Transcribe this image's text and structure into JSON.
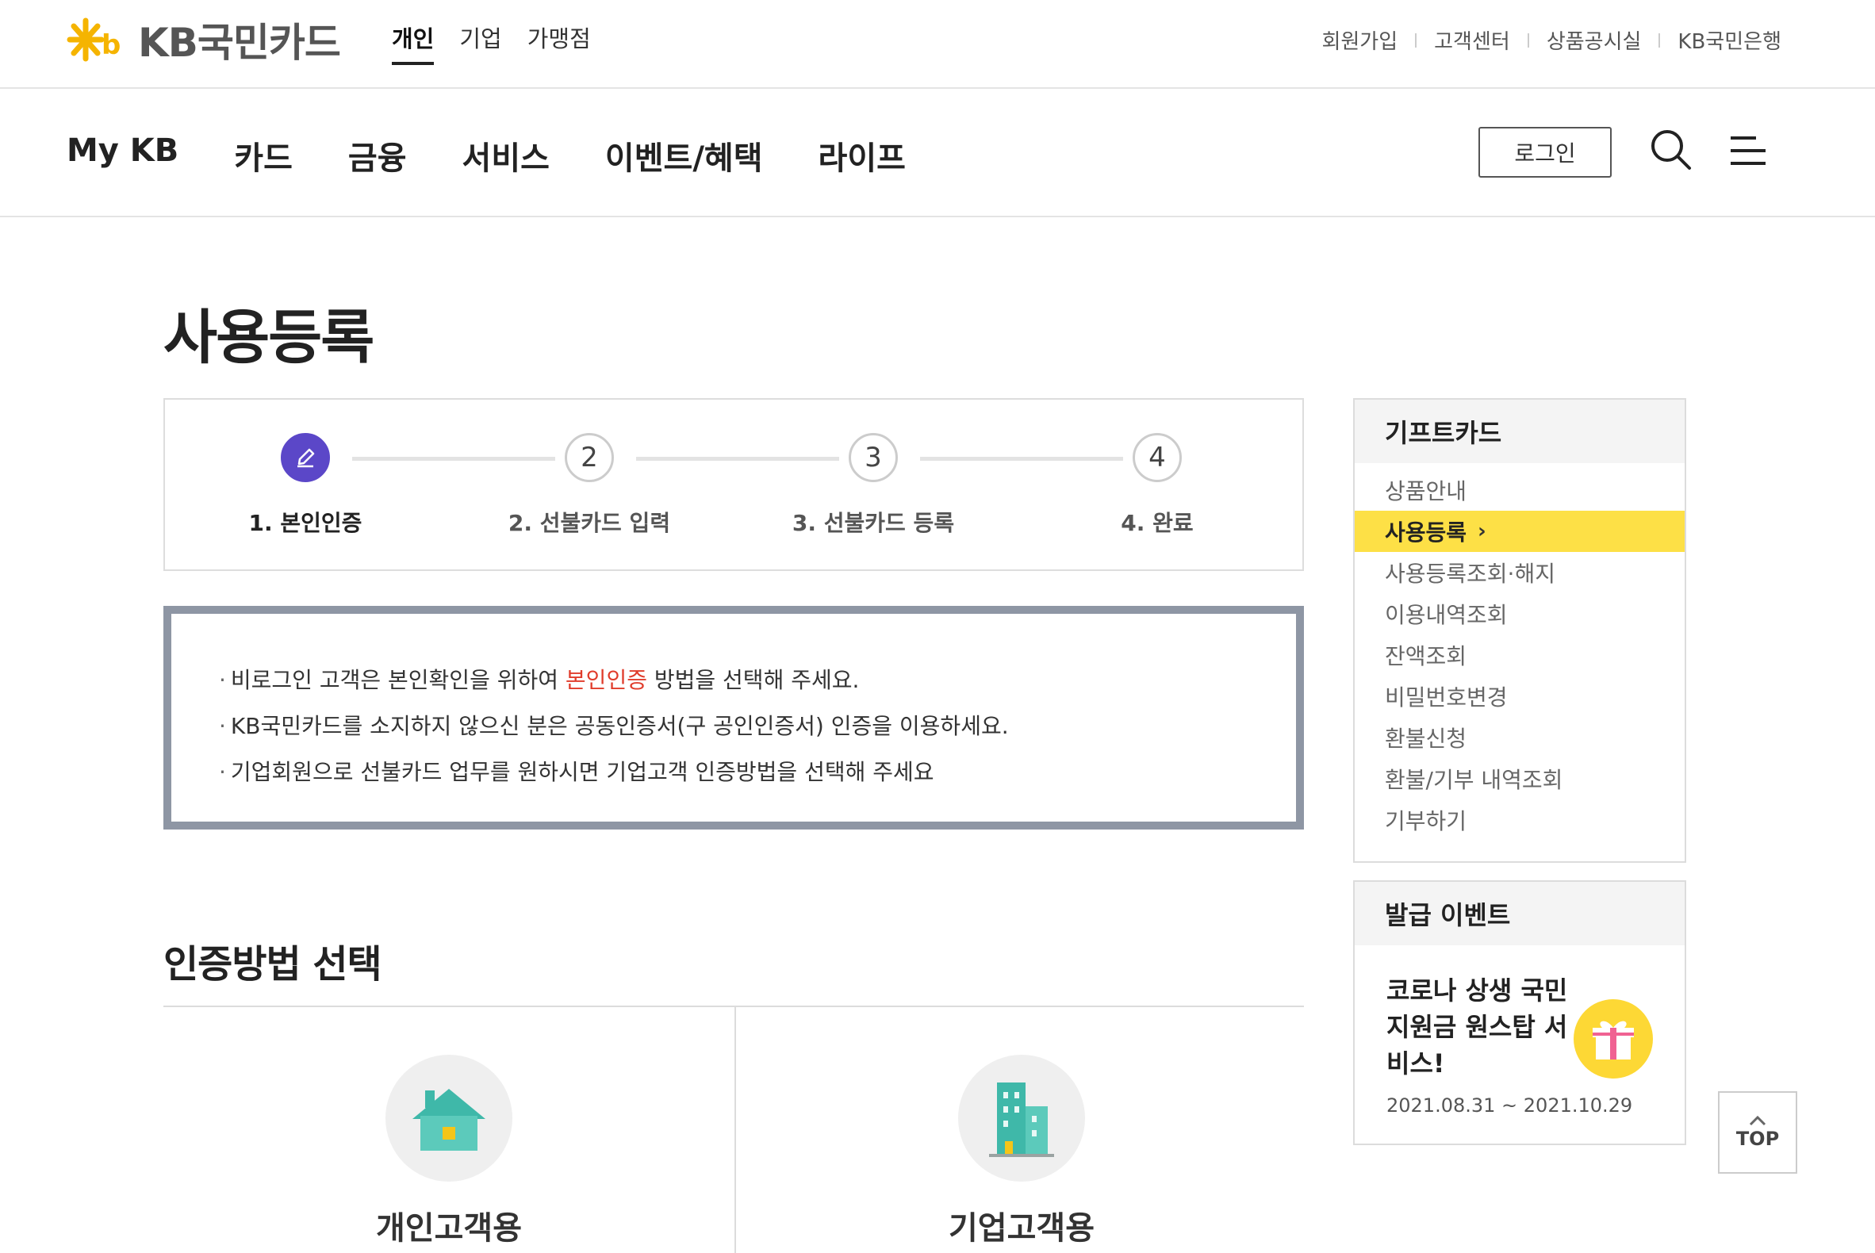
{
  "header": {
    "logo_text": "KB국민카드",
    "segments": [
      "개인",
      "기업",
      "가맹점"
    ],
    "utility_links": [
      "회원가입",
      "고객센터",
      "상품공시실",
      "KB국민은행"
    ]
  },
  "nav": {
    "items": [
      "My KB",
      "카드",
      "금융",
      "서비스",
      "이벤트/혜택",
      "라이프"
    ],
    "login_label": "로그인",
    "search_icon": "search-icon",
    "menu_icon": "hamburger-menu-icon"
  },
  "page": {
    "title": "사용등록"
  },
  "steps": [
    {
      "number": "1",
      "label": "1. 본인인증",
      "active": true,
      "icon": "pencil-icon"
    },
    {
      "number": "2",
      "label": "2. 선불카드 입력",
      "active": false
    },
    {
      "number": "3",
      "label": "3. 선불카드 등록",
      "active": false
    },
    {
      "number": "4",
      "label": "4. 완료",
      "active": false
    }
  ],
  "notice": {
    "line1_before": "비로그인 고객은 본인확인을 위하여 ",
    "line1_highlight": "본인인증",
    "line1_after": " 방법을 선택해 주세요.",
    "line2": "KB국민카드를 소지하지 않으신 분은 공동인증서(구 공인인증서) 인증을 이용하세요.",
    "line3": "기업회원으로 선불카드 업무를 원하시면 기업고객 인증방법을 선택해 주세요",
    "bullet": "·"
  },
  "method": {
    "title": "인증방법 선택",
    "options": [
      {
        "label": "개인고객용",
        "icon": "house-icon"
      },
      {
        "label": "기업고객용",
        "icon": "building-icon"
      }
    ]
  },
  "sidebar": {
    "title": "기프트카드",
    "items": [
      {
        "label": "상품안내",
        "active": false
      },
      {
        "label": "사용등록",
        "active": true
      },
      {
        "label": "사용등록조회·해지",
        "active": false
      },
      {
        "label": "이용내역조회",
        "active": false
      },
      {
        "label": "잔액조회",
        "active": false
      },
      {
        "label": "비밀번호변경",
        "active": false
      },
      {
        "label": "환불신청",
        "active": false
      },
      {
        "label": "환불/기부 내역조회",
        "active": false
      },
      {
        "label": "기부하기",
        "active": false
      }
    ],
    "active_chevron": "›"
  },
  "event": {
    "title": "발급 이벤트",
    "name": "코로나 상생 국민지원금 원스탑 서비스!",
    "date": "2021.08.31 ~ 2021.10.29",
    "icon": "gift-icon"
  },
  "top_button": {
    "label": "TOP"
  },
  "colors": {
    "brand_yellow": "#fde046",
    "step_active": "#5b47c8",
    "highlight_red": "#e03c2b",
    "notice_border": "#8e96a4"
  }
}
